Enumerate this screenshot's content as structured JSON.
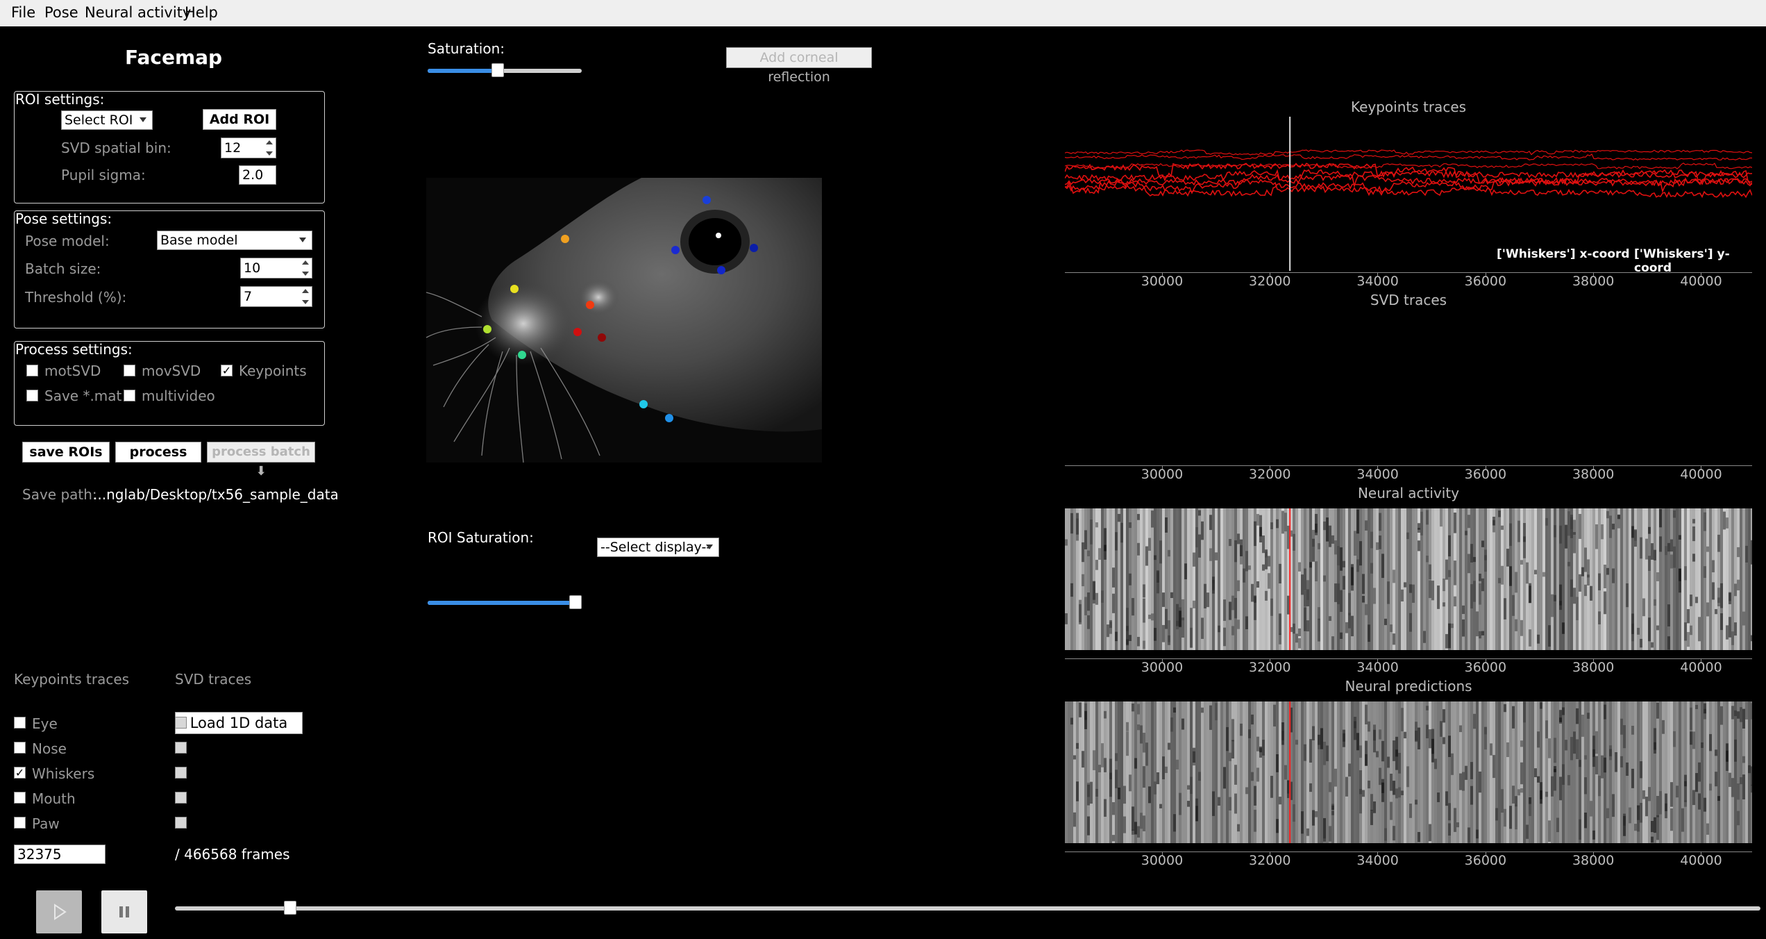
{
  "menu": {
    "items": [
      {
        "label": "File"
      },
      {
        "label": "Pose"
      },
      {
        "label": "Neural activity"
      },
      {
        "label": "Help"
      }
    ]
  },
  "app_title": "Facemap",
  "roi_settings": {
    "title": "ROI settings:",
    "select_roi": "Select ROI",
    "add_roi": "Add ROI",
    "svd_bin_label": "SVD spatial bin:",
    "svd_bin_value": "12",
    "pupil_sigma_label": "Pupil sigma:",
    "pupil_sigma_value": "2.0"
  },
  "pose_settings": {
    "title": "Pose settings:",
    "model_label": "Pose model:",
    "model_value": "Base model",
    "batch_label": "Batch size:",
    "batch_value": "10",
    "threshold_label": "Threshold (%):",
    "threshold_value": "7"
  },
  "process_settings": {
    "title": "Process settings:",
    "motsvd": "motSVD",
    "movsvd": "movSVD",
    "keypoints": "Keypoints",
    "savemat": "Save *.mat",
    "multivideo": "multivideo"
  },
  "buttons": {
    "save_rois": "save ROIs",
    "process": "process",
    "process_batch": "process batch ⬇"
  },
  "save_path": {
    "label": "Save path:",
    "value": "...nglab/Desktop/tx56_sample_data"
  },
  "video": {
    "saturation_label": "Saturation:",
    "saturation_level": 0.45,
    "corneal_button": "Add corneal reflection",
    "roi_saturation_label": "ROI Saturation:",
    "roi_saturation_level": 1.0,
    "display_select": "--Select display--"
  },
  "traces_panel": {
    "keypoints_header": "Keypoints traces",
    "svd_header": "SVD traces",
    "load_1d": "Load 1D data",
    "keypoints": [
      {
        "label": "Eye",
        "checked": false
      },
      {
        "label": "Nose",
        "checked": false
      },
      {
        "label": "Whiskers",
        "checked": true
      },
      {
        "label": "Mouth",
        "checked": false
      },
      {
        "label": "Paw",
        "checked": false
      }
    ],
    "frame_value": "32375",
    "frame_total": "/ 466568 frames"
  },
  "playback": {
    "play_icon": "play-icon",
    "pause_icon": "pause-icon",
    "position_fraction": 0.0694
  },
  "plots": {
    "keypoints_title": "Keypoints traces",
    "legend_x": "['Whiskers'] x-coord",
    "legend_y": "['Whiskers'] y-coord",
    "svd_title": "SVD traces",
    "neural_title": "Neural activity",
    "predictions_title": "Neural predictions",
    "ticks": [
      "30000",
      "32000",
      "34000",
      "36000",
      "38000",
      "40000"
    ],
    "trace_color": "#e01010",
    "cursor_color": "#ff2020"
  },
  "chart_data": {
    "type": "line",
    "title": "Keypoints traces",
    "x_ticks": [
      30000,
      32000,
      34000,
      36000,
      38000,
      40000
    ],
    "xlim": [
      28200,
      40950
    ],
    "cursor_frame": 32375,
    "series": [
      {
        "name": "['Whiskers'] x-coord"
      },
      {
        "name": "['Whiskers'] y-coord"
      }
    ]
  }
}
